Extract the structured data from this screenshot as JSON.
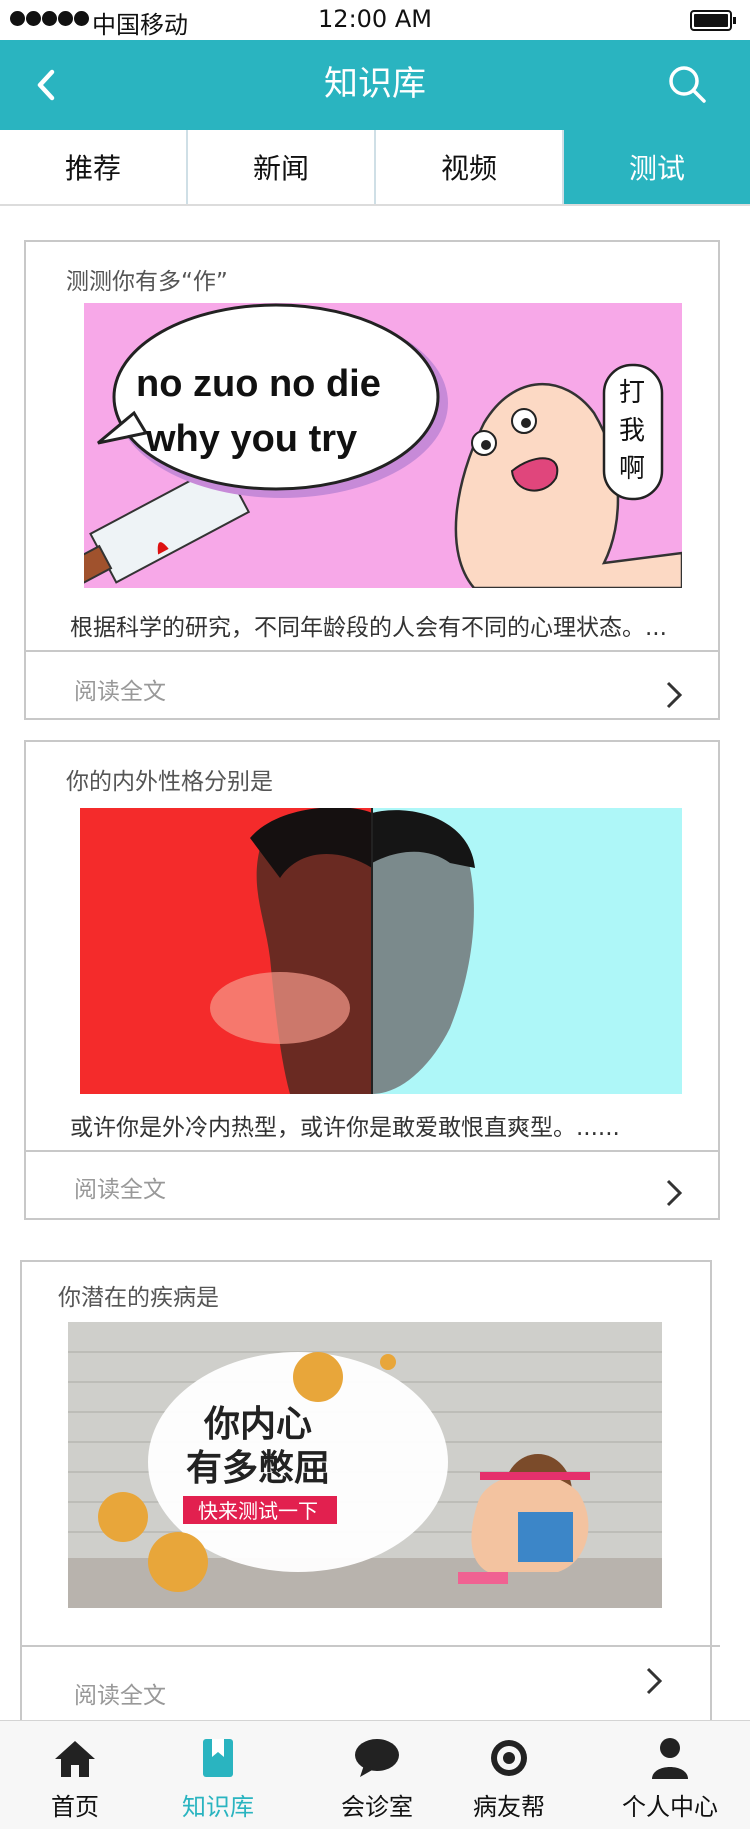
{
  "status_bar": {
    "carrier": "中国移动",
    "time": "12:00 AM"
  },
  "nav": {
    "title": "知识库",
    "back_icon": "chevron-left-icon",
    "search_icon": "search-icon"
  },
  "tabs": [
    {
      "label": "推荐",
      "active": false
    },
    {
      "label": "新闻",
      "active": false
    },
    {
      "label": "视频",
      "active": false
    },
    {
      "label": "测试",
      "active": true
    }
  ],
  "cards": [
    {
      "title": "测测你有多“作”",
      "image": {
        "speech": [
          "no zuo no die",
          "why you try"
        ],
        "side_text": [
          "打",
          "我",
          "啊"
        ]
      },
      "description": "根据科学的研究，不同年龄段的人会有不同的心理状态。...",
      "read_more": "阅读全文"
    },
    {
      "title": "你的内外性格分别是",
      "description": "或许你是外冷内热型，或许你是敢爱敢恨直爽型。......",
      "read_more": "阅读全文"
    },
    {
      "title": "你潜在的疾病是",
      "image": {
        "headline": [
          "你内心",
          "有多憋屈"
        ],
        "button": "快来测试一下"
      },
      "read_more": "阅读全文"
    }
  ],
  "bottom_nav": [
    {
      "label": "首页",
      "icon": "home-icon",
      "active": false
    },
    {
      "label": "知识库",
      "icon": "bookmark-book-icon",
      "active": true
    },
    {
      "label": "会诊室",
      "icon": "chat-bubble-icon",
      "active": false
    },
    {
      "label": "病友帮",
      "icon": "target-circle-icon",
      "active": false
    },
    {
      "label": "个人中心",
      "icon": "person-icon",
      "active": false
    }
  ],
  "colors": {
    "accent": "#2ab4c0",
    "border": "#c8c8c8"
  }
}
